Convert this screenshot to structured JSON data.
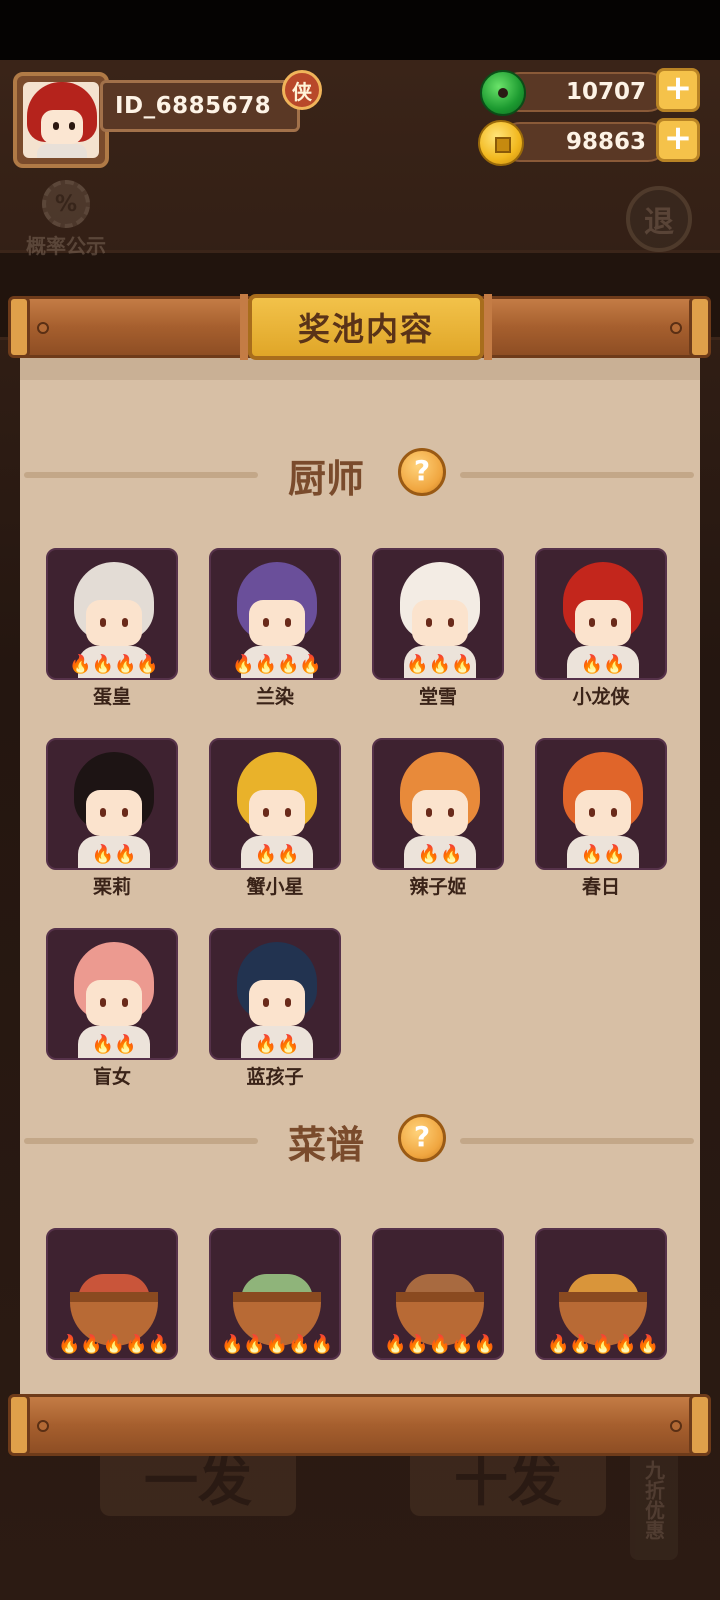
{
  "player": {
    "id": "ID_6885678",
    "title_badge": "侠"
  },
  "currencies": {
    "jade": "10707",
    "coins": "98863",
    "plus": "+"
  },
  "side": {
    "probability_label": "概率公示",
    "probability_icon": "%",
    "back_label": "退"
  },
  "panel": {
    "title": "奖池内容"
  },
  "chefs_section": {
    "title": "厨师",
    "help": "?",
    "chefs": [
      {
        "name": "蛋皇",
        "stars": 4,
        "hair": "#e3dcd5"
      },
      {
        "name": "兰染",
        "stars": 4,
        "hair": "#6a4f9a"
      },
      {
        "name": "堂雪",
        "stars": 3,
        "hair": "#f3ece4"
      },
      {
        "name": "小龙侠",
        "stars": 2,
        "hair": "#c3261c"
      },
      {
        "name": "栗莉",
        "stars": 2,
        "hair": "#1d1414"
      },
      {
        "name": "蟹小星",
        "stars": 2,
        "hair": "#e9b22a"
      },
      {
        "name": "辣子姬",
        "stars": 2,
        "hair": "#e88a3a"
      },
      {
        "name": "春日",
        "stars": 2,
        "hair": "#e0652a"
      },
      {
        "name": "盲女",
        "stars": 2,
        "hair": "#ec9a90"
      },
      {
        "name": "蓝孩子",
        "stars": 2,
        "hair": "#223350"
      }
    ]
  },
  "recipes_section": {
    "title": "菜谱",
    "help": "?",
    "recipes": [
      {
        "stars": 5,
        "color": "#c9553a"
      },
      {
        "stars": 5,
        "color": "#8fb47a"
      },
      {
        "stars": 5,
        "color": "#a86a40"
      },
      {
        "stars": 5,
        "color": "#d9953a"
      }
    ]
  },
  "background": {
    "single_draw": "一发",
    "ten_draw": "十发",
    "discount": "九折优惠"
  },
  "colors": {
    "paper": "#d7bfa5",
    "tile": "#3e2230",
    "accent_gold": "#f2c24a",
    "wood": "#a65f2e"
  }
}
